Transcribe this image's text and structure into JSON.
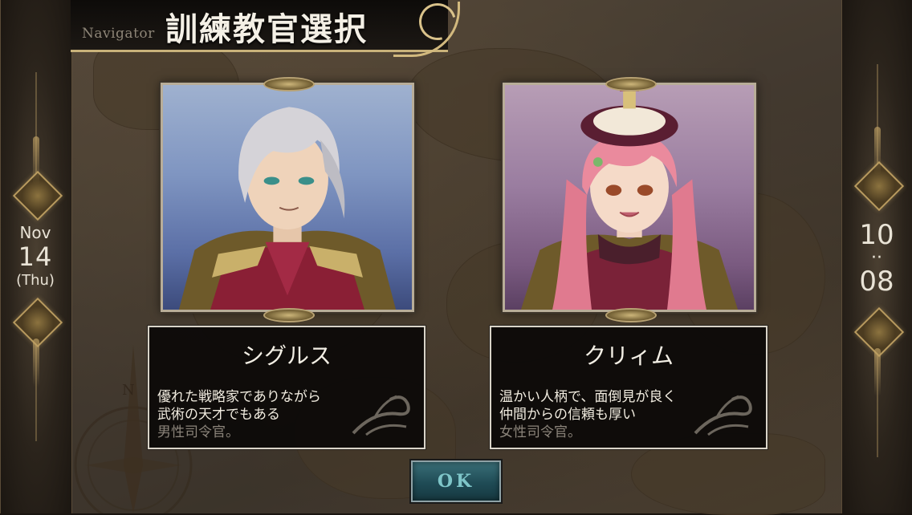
{
  "header": {
    "navigator_label": "Navigator",
    "title": "訓練教官選択"
  },
  "date": {
    "month": "Nov",
    "day": "14",
    "weekday": "(Thu)"
  },
  "clock": {
    "hour": "10",
    "separator": "··",
    "minute": "08"
  },
  "characters": [
    {
      "name": "シグルス",
      "description_lines": [
        "優れた戦略家でありながら",
        "武術の天才でもある"
      ],
      "role": "男性司令官。",
      "background_color": "#7f95c1"
    },
    {
      "name": "クリィム",
      "description_lines": [
        "温かい人柄で、面倒見が良く",
        "仲間からの信頼も厚い"
      ],
      "role": "女性司令官。",
      "background_color": "#9a7da0"
    }
  ],
  "buttons": {
    "ok_label": "OK"
  },
  "colors": {
    "gold_accent": "#c9b27a",
    "ok_button": "#1f4b55",
    "card_border": "#d9d4c8"
  }
}
